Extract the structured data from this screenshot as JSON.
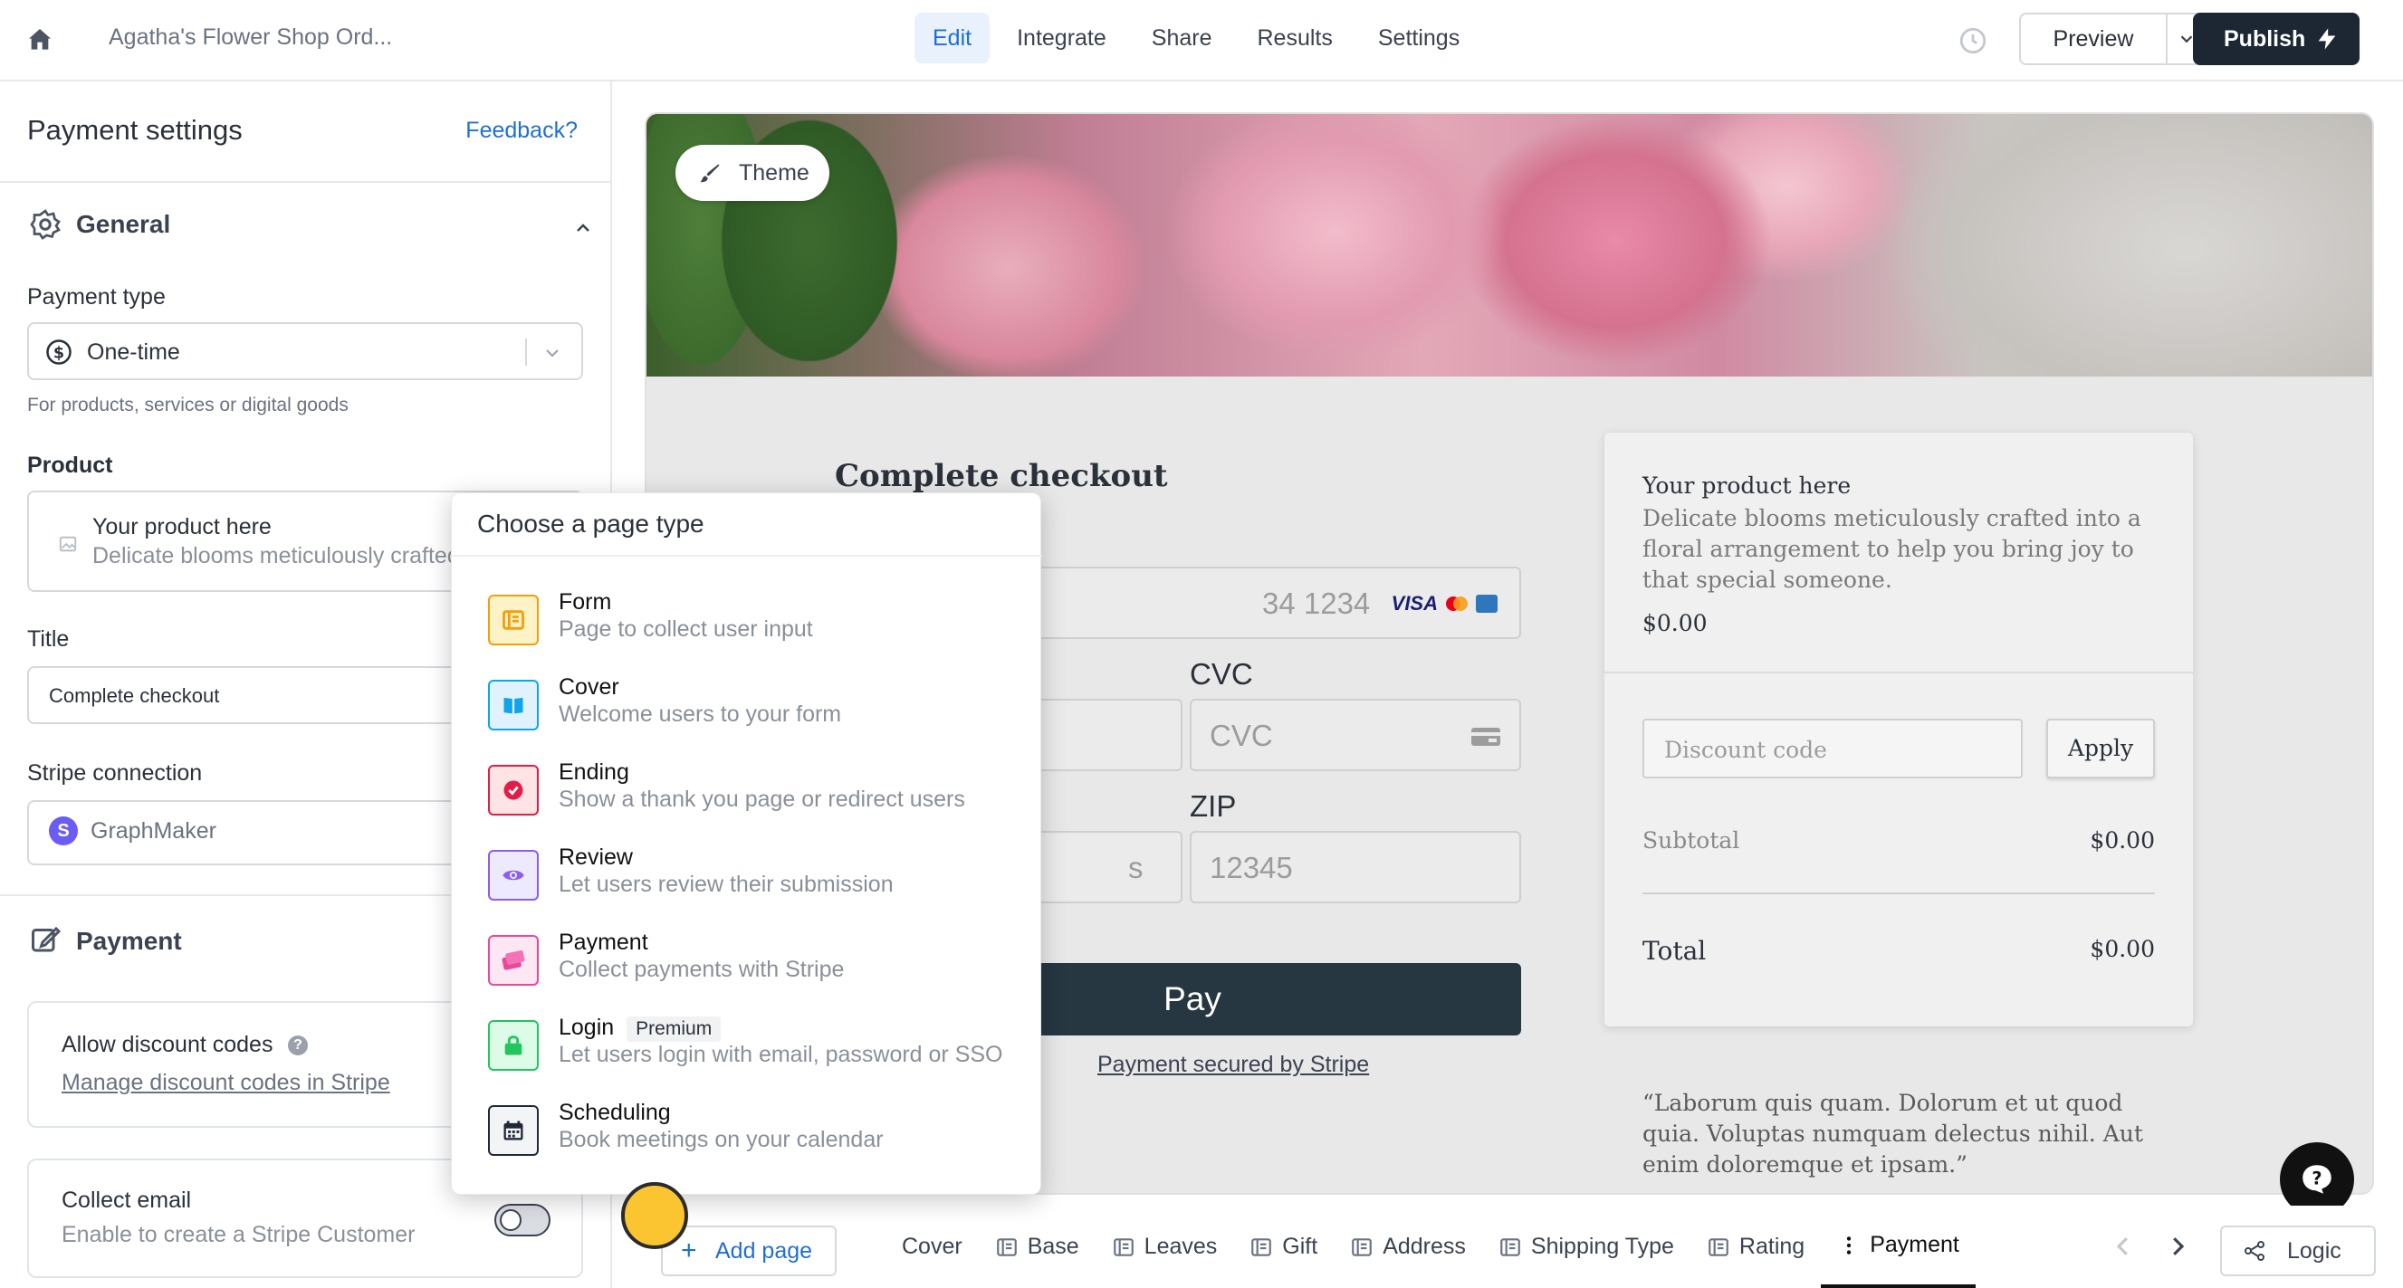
{
  "app": {
    "doc_title": "Agatha's Flower Shop Ord...",
    "nav": [
      {
        "label": "Edit",
        "active": true
      },
      {
        "label": "Integrate"
      },
      {
        "label": "Share"
      },
      {
        "label": "Results"
      },
      {
        "label": "Settings"
      }
    ],
    "preview_label": "Preview",
    "publish_label": "Publish"
  },
  "left_panel": {
    "title": "Payment settings",
    "feedback": "Feedback?",
    "general": {
      "title": "General",
      "payment_type_label": "Payment type",
      "payment_type_value": "One-time",
      "payment_type_helper": "For products, services or digital goods",
      "product_label": "Product",
      "product_title": "Your product here",
      "product_desc": "Delicate blooms meticulously crafted into a floral arrangement",
      "title_label": "Title",
      "title_value": "Complete checkout",
      "stripe_label": "Stripe connection",
      "stripe_value": "GraphMaker"
    },
    "payment": {
      "title": "Payment",
      "discount_title": "Allow discount codes",
      "discount_link": "Manage discount codes in Stripe",
      "email_title": "Collect email",
      "email_desc": "Enable to create a Stripe Customer",
      "email_enabled": false
    }
  },
  "canvas": {
    "theme_label": "Theme",
    "checkout_title": "Complete checkout",
    "card_placeholder": "34 1234",
    "card_brands": "VISA",
    "cvc_label": "CVC",
    "cvc_placeholder": "CVC",
    "zip_label": "ZIP",
    "zip_placeholder": "12345",
    "city_placeholder": "s",
    "pay_label": "Pay",
    "secured_label": "Payment secured by Stripe",
    "summary": {
      "product_title": "Your product here",
      "product_desc": "Delicate blooms meticulously crafted into a floral arrangement to help you bring joy to that special someone.",
      "product_price": "$0.00",
      "discount_placeholder": "Discount code",
      "apply_label": "Apply",
      "subtotal_label": "Subtotal",
      "subtotal_value": "$0.00",
      "total_label": "Total",
      "total_value": "$0.00"
    },
    "quote": "“Laborum quis quam. Dolorum et ut quod quia. Voluptas numquam delectus nihil. Aut enim doloremque et ipsam.”"
  },
  "popup": {
    "title": "Choose a page type",
    "items": [
      {
        "title": "Form",
        "desc": "Page to collect user input",
        "icon": "form-icon",
        "color": "#f59e0b"
      },
      {
        "title": "Cover",
        "desc": "Welcome users to your form",
        "icon": "book-icon",
        "color": "#0ea5e9"
      },
      {
        "title": "Ending",
        "desc": "Show a thank you page or redirect users",
        "icon": "check-circle-icon",
        "color": "#e11d48"
      },
      {
        "title": "Review",
        "desc": "Let users review their submission",
        "icon": "eye-icon",
        "color": "#8b5cf6"
      },
      {
        "title": "Payment",
        "desc": "Collect payments with Stripe",
        "icon": "credit-card-icon",
        "color": "#ec4899"
      },
      {
        "title": "Login",
        "desc": "Let users login with email, password or SSO",
        "icon": "lock-icon",
        "color": "#22c55e",
        "badge": "Premium"
      },
      {
        "title": "Scheduling",
        "desc": "Book meetings on your calendar",
        "icon": "calendar-icon",
        "color": "#1f2937"
      }
    ]
  },
  "pagebar": {
    "add_page": "Add page",
    "tabs": [
      {
        "label": "Cover",
        "icon": "none"
      },
      {
        "label": "Base",
        "icon": "form-icon"
      },
      {
        "label": "Leaves",
        "icon": "form-icon"
      },
      {
        "label": "Gift",
        "icon": "form-icon"
      },
      {
        "label": "Address",
        "icon": "form-icon"
      },
      {
        "label": "Shipping Type",
        "icon": "form-icon"
      },
      {
        "label": "Rating",
        "icon": "form-icon"
      },
      {
        "label": "Payment",
        "icon": "vertical-dots-icon",
        "active": true
      }
    ],
    "logic_label": "Logic"
  }
}
